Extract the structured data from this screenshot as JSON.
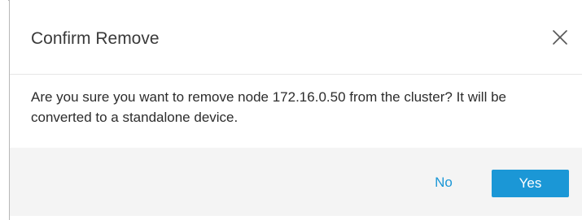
{
  "dialog": {
    "title": "Confirm Remove",
    "message": "Are you sure you want to remove node 172.16.0.50 from the cluster? It will be converted to a standalone device.",
    "buttons": {
      "no_label": "No",
      "yes_label": "Yes"
    },
    "icons": {
      "close": "close-icon"
    },
    "colors": {
      "accent": "#1b97d6",
      "footer_bg": "#f4f4f4",
      "title_text": "#3a3a3a"
    }
  }
}
